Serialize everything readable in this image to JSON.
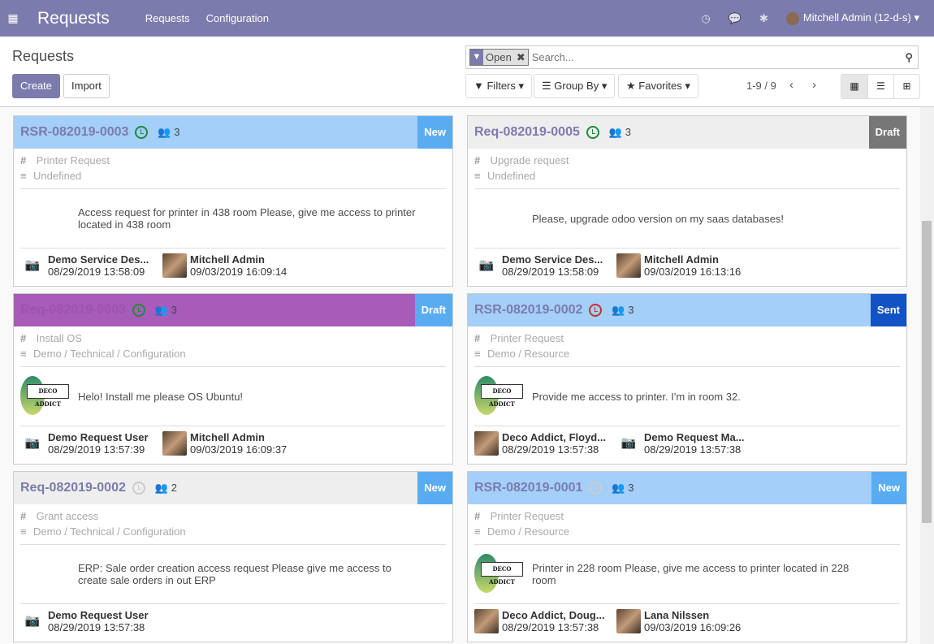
{
  "nav": {
    "app_title": "Requests",
    "menu": [
      "Requests",
      "Configuration"
    ],
    "user": "Mitchell Admin (12-d-s)"
  },
  "control": {
    "breadcrumb": "Requests",
    "create": "Create",
    "import": "Import",
    "facet": "Open",
    "search_placeholder": "Search...",
    "filters": "Filters",
    "group_by": "Group By",
    "favorites": "Favorites",
    "pager": "1-9 / 9"
  },
  "colors": {
    "accent": "#7c7bad"
  },
  "cards": [
    {
      "title": "RSR-082019-0003",
      "clock": "#1e8b3a",
      "followers": "3",
      "stage": "New",
      "stage_color": "#5aacf2",
      "header_bg": "#a4cff8",
      "title_color": "#7c7bad",
      "type": "Printer Request",
      "category": "Undefined",
      "logo": false,
      "description": "Access request for printer in 438 room Please, give me access to printer located in 438 room",
      "users": [
        {
          "name": "Demo Service Des...",
          "date": "08/29/2019 13:58:09",
          "photo": false
        },
        {
          "name": "Mitchell Admin",
          "date": "09/03/2019 16:09:14",
          "photo": true
        }
      ]
    },
    {
      "title": "Req-082019-0005",
      "clock": "#1e8b3a",
      "followers": "3",
      "stage": "Draft",
      "stage_color": "#777777",
      "header_bg": "#eeeeee",
      "title_color": "#7c7bad",
      "type": "Upgrade request",
      "category": "Undefined",
      "logo": false,
      "description": "Please, upgrade odoo version on my saas databases!",
      "users": [
        {
          "name": "Demo Service Des...",
          "date": "08/29/2019 13:58:09",
          "photo": false
        },
        {
          "name": "Mitchell Admin",
          "date": "09/03/2019 16:13:16",
          "photo": true
        }
      ]
    },
    {
      "title": "Req-082019-0003",
      "clock": "#1e8b3a",
      "followers": "3",
      "stage": "Draft",
      "stage_color": "#5aacf2",
      "header_bg": "#a85bb8",
      "title_color": "#9a55ad",
      "type": "Install OS",
      "category": "Demo / Technical / Configuration",
      "logo": true,
      "logo_text": "DECO ADDICT",
      "description": "Helo! Install me please OS Ubuntu!",
      "users": [
        {
          "name": "Demo Request User",
          "date": "08/29/2019 13:57:39",
          "photo": false
        },
        {
          "name": "Mitchell Admin",
          "date": "09/03/2019 16:09:37",
          "photo": true
        }
      ]
    },
    {
      "title": "RSR-082019-0002",
      "clock": "#c9302c",
      "followers": "3",
      "stage": "Sent",
      "stage_color": "#1352c4",
      "header_bg": "#a4cff8",
      "title_color": "#7c7bad",
      "type": "Printer Request",
      "category": "Demo / Resource",
      "logo": true,
      "logo_text": "DECO ADDICT",
      "description": "Provide me access to printer. I'm in room 32.",
      "users": [
        {
          "name": "Deco Addict, Floyd...",
          "date": "08/29/2019 13:57:38",
          "photo": true
        },
        {
          "name": "Demo Request Ma...",
          "date": "08/29/2019 13:57:38",
          "photo": false
        }
      ]
    },
    {
      "title": "Req-082019-0002",
      "clock": "#cccccc",
      "followers": "2",
      "stage": "New",
      "stage_color": "#5aacf2",
      "header_bg": "#eeeeee",
      "title_color": "#7c7bad",
      "type": "Grant access",
      "category": "Demo / Technical / Configuration",
      "logo": false,
      "description": "ERP: Sale order creation access request Please give me access to create sale orders in out ERP",
      "users": [
        {
          "name": "Demo Request User",
          "date": "08/29/2019 13:57:38",
          "photo": false
        }
      ]
    },
    {
      "title": "RSR-082019-0001",
      "clock": "#cccccc",
      "followers": "3",
      "stage": "New",
      "stage_color": "#5aacf2",
      "header_bg": "#a4cff8",
      "title_color": "#7c7bad",
      "type": "Printer Request",
      "category": "Demo / Resource",
      "logo": true,
      "logo_text": "DECO ADDICT",
      "description": "Printer in 228 room Please, give me access to printer located in 228 room",
      "users": [
        {
          "name": "Deco Addict, Doug...",
          "date": "08/29/2019 13:57:38",
          "photo": true
        },
        {
          "name": "Lana Nilssen",
          "date": "09/03/2019 16:09:26",
          "photo": true
        }
      ]
    }
  ]
}
